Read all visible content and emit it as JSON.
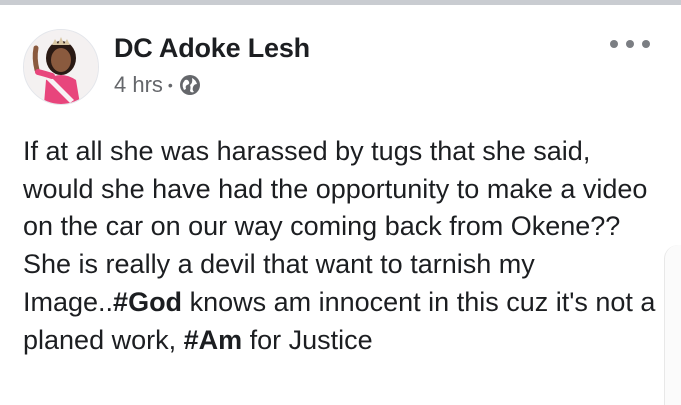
{
  "post": {
    "author": "DC Adoke Lesh",
    "time": "4 hrs",
    "separator": "•",
    "privacy_icon": "globe-icon",
    "more_icon": "more-options-icon",
    "avatar_icon": "profile-photo",
    "paragraph1": "If at all she was harassed by tugs that she said, would she have had the opportunity to make a video on the car on our way coming back from Okene??",
    "paragraph2_part1": "She is really a devil that want to tarnish my Image..",
    "hashtag_god": "#God",
    "paragraph2_part2": " knows am innocent in this cuz it's not a planed work, ",
    "hashtag_am": "#Am",
    "paragraph2_part3": " for Justice"
  },
  "colors": {
    "text": "#1c1e21",
    "meta": "#65676b",
    "divider": "#c9ccd1"
  }
}
